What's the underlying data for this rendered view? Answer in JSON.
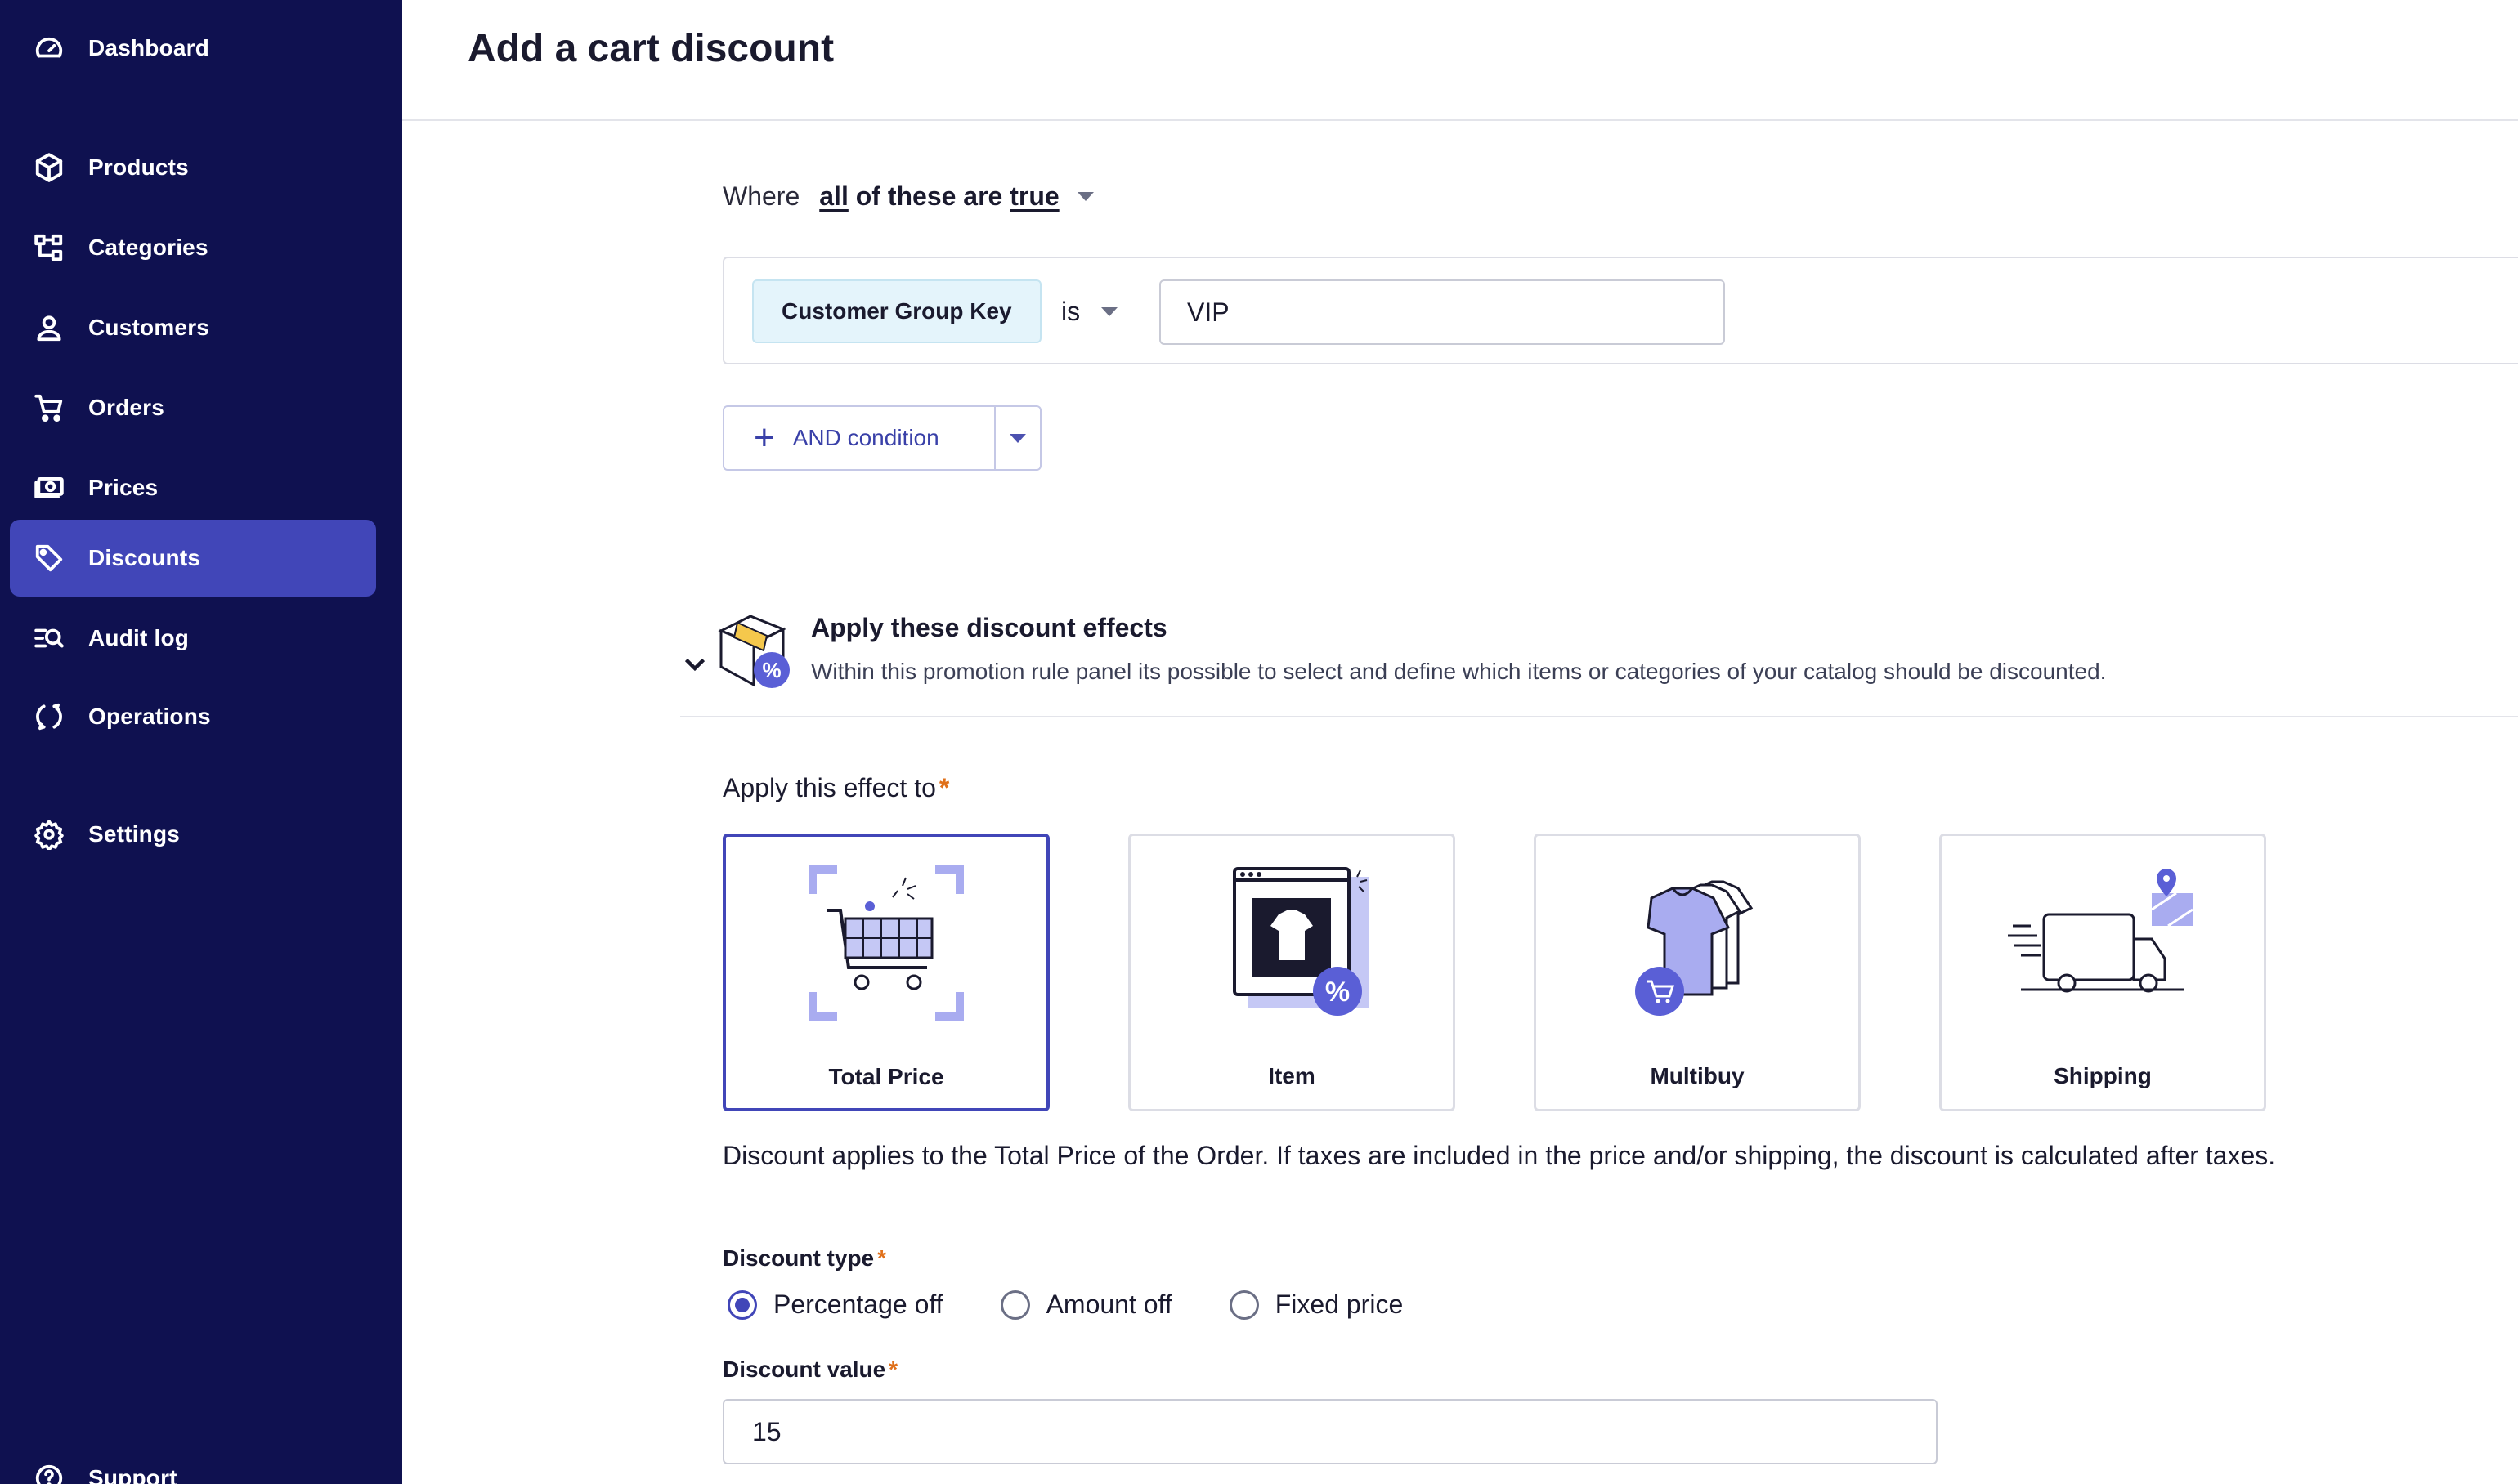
{
  "sidebar": {
    "items": [
      {
        "label": "Dashboard",
        "icon": "gauge-icon"
      },
      {
        "label": "Products",
        "icon": "cube-icon"
      },
      {
        "label": "Categories",
        "icon": "hierarchy-icon"
      },
      {
        "label": "Customers",
        "icon": "user-icon"
      },
      {
        "label": "Orders",
        "icon": "cart-icon"
      },
      {
        "label": "Prices",
        "icon": "money-icon"
      },
      {
        "label": "Discounts",
        "icon": "tag-icon",
        "active": true
      },
      {
        "label": "Audit log",
        "icon": "search-list-icon"
      },
      {
        "label": "Operations",
        "icon": "sync-icon"
      },
      {
        "label": "Settings",
        "icon": "gear-icon"
      },
      {
        "label": "Support",
        "icon": "help-icon"
      }
    ]
  },
  "header": {
    "title": "Add a cart discount"
  },
  "conditions": {
    "where_prefix": "Where",
    "where_all": "all",
    "where_middle": "of these are",
    "where_true": "true",
    "field": "Customer Group Key",
    "operator": "is",
    "value": "VIP",
    "and_button": "AND condition"
  },
  "effects": {
    "title": "Apply these discount effects",
    "description": "Within this promotion rule panel its possible to select and define which items or categories of your catalog should be discounted.",
    "apply_label": "Apply this effect to",
    "required_mark": "*",
    "options": [
      "Total Price",
      "Item",
      "Multibuy",
      "Shipping"
    ],
    "selected": "Total Price",
    "apply_description": "Discount applies to the Total Price of the Order. If taxes are included in the price and/or shipping, the discount is calculated after taxes."
  },
  "discount": {
    "type_label": "Discount type",
    "types": [
      "Percentage off",
      "Amount off",
      "Fixed price"
    ],
    "selected_type": "Percentage off",
    "value_label": "Discount value",
    "value": "15"
  },
  "colors": {
    "sidebar_bg": "#0f1150",
    "active_item": "#4146b8",
    "accent": "#4146b8",
    "required": "#e0701a"
  }
}
